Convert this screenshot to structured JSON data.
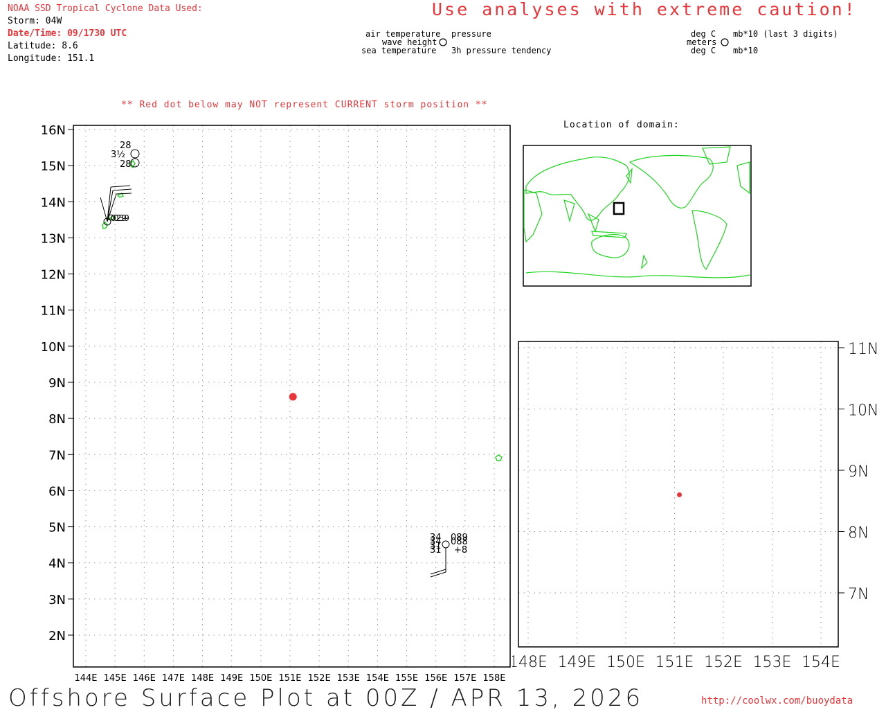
{
  "header": {
    "source": "NOAA SSD Tropical Cyclone Data Used:",
    "storm": "Storm: 04W",
    "datetime": "Date/Time: 09/1730 UTC",
    "latitude": "Latitude: 8.6",
    "longitude": "Longitude: 151.1",
    "caution": "Use analyses with extreme caution!",
    "red_dot_note": "** Red dot below may NOT represent CURRENT storm position **"
  },
  "legend_left": {
    "air_temperature": "air temperature",
    "wave_height": "wave height",
    "sea_temperature": "sea temperature",
    "pressure": "pressure",
    "pressure_tendency": "3h pressure tendency"
  },
  "legend_right": {
    "deg_c_top": "deg C",
    "meters": "meters",
    "deg_c_bottom": "deg C",
    "mb_last3": "mb*10 (last 3 digits)",
    "mb": "mb*10"
  },
  "inset_world": {
    "label": "Location of domain:"
  },
  "footer": {
    "title": "Offshore Surface Plot at 00Z / APR 13, 2026",
    "url": "http://coolwx.com/buoydata"
  },
  "colors": {
    "storm": "#e8353a",
    "land": "#1fd41f",
    "grid": "#9a9a9a",
    "frame": "#000000"
  },
  "main_map": {
    "lat_labels": [
      "2N",
      "3N",
      "4N",
      "5N",
      "6N",
      "7N",
      "8N",
      "9N",
      "10N",
      "11N",
      "12N",
      "13N",
      "14N",
      "15N",
      "16N"
    ],
    "lon_labels": [
      "144E",
      "145E",
      "146E",
      "147E",
      "148E",
      "149E",
      "150E",
      "151E",
      "152E",
      "153E",
      "154E",
      "155E",
      "156E",
      "157E",
      "158E"
    ],
    "storm_position": {
      "lat": 8.6,
      "lon": 151.1
    },
    "stations": [
      {
        "lat": 15.2,
        "lon": 145.7,
        "texts": [
          "28",
          "3½",
          "28"
        ]
      },
      {
        "lat": 13.5,
        "lon": 144.8,
        "texts": [
          "029",
          "059"
        ]
      },
      {
        "lat": 4.6,
        "lon": 156.4,
        "texts": [
          "34",
          "089",
          "34",
          "088",
          "31",
          "+8",
          "31"
        ]
      }
    ]
  },
  "zoom_map": {
    "lat_labels": [
      "7N",
      "8N",
      "9N",
      "10N",
      "11N"
    ],
    "lon_labels": [
      "148E",
      "149E",
      "150E",
      "151E",
      "152E",
      "153E",
      "154E"
    ],
    "storm_position": {
      "lat": 8.6,
      "lon": 151.1
    }
  }
}
